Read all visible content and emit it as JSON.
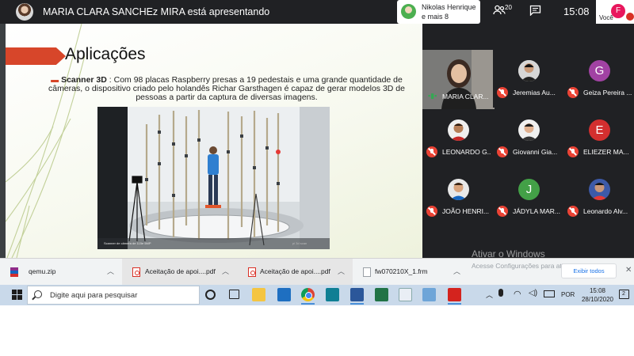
{
  "meet": {
    "presenter_title": "MARIA CLARA SANCHEz MIRA está apresentando",
    "pinned_name_line1": "Nikolas Henrique",
    "pinned_name_line2": "e mais 8",
    "participant_count": "20",
    "clock": "15:08",
    "you_label": "Você",
    "you_initial": "F",
    "participants": [
      {
        "name": "MARIA CLAR...",
        "muted": false
      },
      {
        "name": "Jeremias Au...",
        "muted": true
      },
      {
        "name": "Geiza Pereira ...",
        "initial": "G",
        "color": "#a142a3",
        "muted": true
      },
      {
        "name": "LEONARDO G...",
        "muted": true
      },
      {
        "name": "Giovanni Gia...",
        "muted": true
      },
      {
        "name": "ELIEZER MA...",
        "initial": "E",
        "color": "#d32f2f",
        "muted": true
      },
      {
        "name": "JOÃO HENRI...",
        "muted": true
      },
      {
        "name": "JÁDYLA MAR...",
        "initial": "J",
        "color": "#43a047",
        "muted": true
      },
      {
        "name": "Leonardo Alv...",
        "muted": true
      }
    ]
  },
  "slide": {
    "title": "Aplicações",
    "bullet_lead": "Scanner 3D",
    "bullet_text": " :  Com 98 placas Raspberry presas a 19 pedestais e uma grande quantidade de câmeras, o dispositivo criado pelo holandês Richar Garsthagen é capaz de gerar modelos 3D de pessoas a partir da captura de diversas imagens.",
    "photo_caption_left": "Scanner de câmera de 115e 5MP",
    "photo_caption_right": "pi 3d scan"
  },
  "overlay": {
    "activate_windows": "Ativar o Windows",
    "activate_sub": "Acesse Configurações para ativar o Windows."
  },
  "downloads": {
    "items": [
      "qemu.zip",
      "Aceitação de apoi....pdf",
      "Aceitação de apoi....pdf",
      "fw070210X_1.frm"
    ],
    "show_all": "Exibir todos"
  },
  "taskbar": {
    "search_placeholder": "Digite aqui para pesquisar",
    "language": "POR",
    "time": "15:08",
    "date": "28/10/2020",
    "notification_count": "2"
  },
  "colors": {
    "accent_orange": "#d7462a",
    "meet_bg": "#202124",
    "mute_red": "#ea4335"
  }
}
